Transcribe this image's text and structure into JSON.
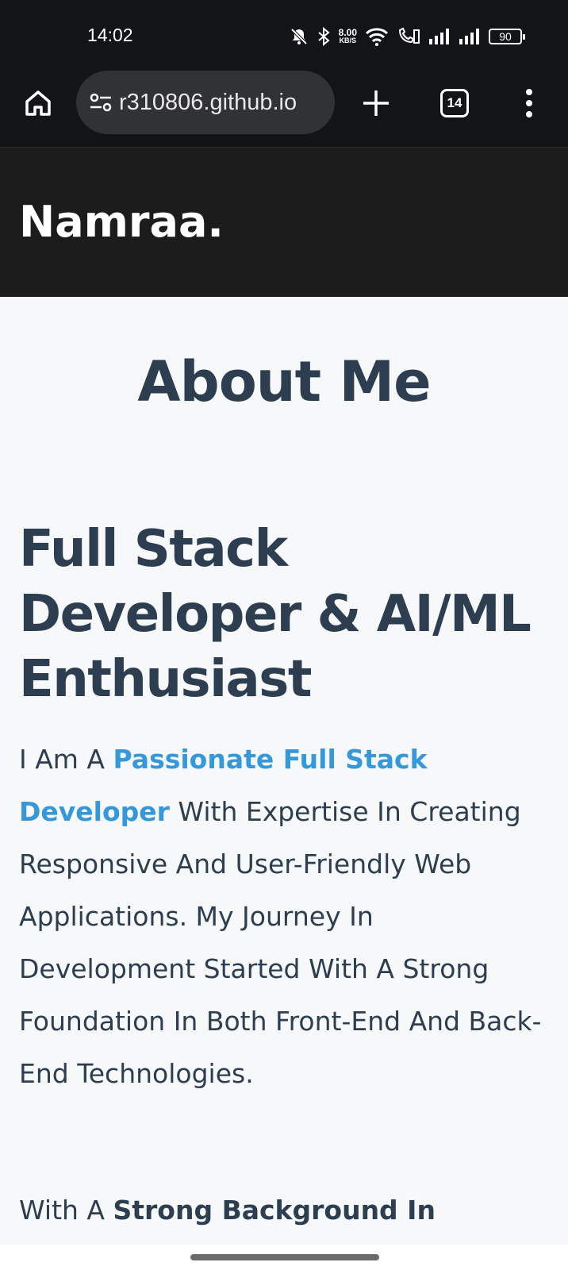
{
  "status_bar": {
    "time": "14:02",
    "net_speed_value": "8.00",
    "net_speed_unit": "KB/S",
    "battery": "90",
    "icons": [
      "mute-icon",
      "bluetooth-icon",
      "wifi-icon",
      "volte-call-icon",
      "signal-1-icon",
      "signal-2-icon",
      "battery-icon"
    ]
  },
  "browser": {
    "url": "r310806.github.io",
    "tab_count": "14",
    "icons": [
      "home-icon",
      "site-settings-icon",
      "plus-icon",
      "tab-switcher-icon",
      "more-vert-icon"
    ]
  },
  "site": {
    "brand": "Namraa."
  },
  "about": {
    "section_title": "About Me",
    "subtitle": "Full Stack Developer & AI/ML Enthusiast",
    "para1_lead": "I Am A ",
    "para1_highlight": "Passionate Full Stack Developer",
    "para1_rest": " With Expertise In Creating Responsive And User-Friendly Web Applications. My Journey In Development Started With A Strong Foundation In Both Front-End And Back-End Technologies.",
    "para2_lead": "With A ",
    "para2_strong": "Strong Background In"
  },
  "colors": {
    "heading": "#2c3e50",
    "accent": "#3498db",
    "header_bg": "#1c1c1c",
    "page_bg": "#f7f8fa",
    "browser_bg": "#131417"
  }
}
